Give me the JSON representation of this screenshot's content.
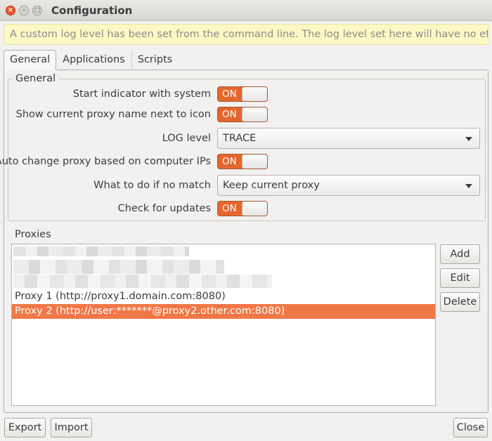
{
  "window": {
    "title": "Configuration",
    "close_glyph": "×",
    "min_glyph": "–",
    "max_glyph": "□"
  },
  "infobar": {
    "text": "A custom log level has been set from the command line. The log level set here will have no effect."
  },
  "tabs": [
    {
      "label": "General"
    },
    {
      "label": "Applications"
    },
    {
      "label": "Scripts"
    }
  ],
  "general": {
    "group_title": "General",
    "start_indicator": {
      "label": "Start indicator with system",
      "state": "ON"
    },
    "show_proxy_name": {
      "label": "Show current proxy name next to icon",
      "state": "ON"
    },
    "log_level": {
      "label": "LOG level",
      "value": "TRACE"
    },
    "auto_change": {
      "label": "Auto change proxy based on computer IPs",
      "state": "ON"
    },
    "no_match": {
      "label": "What to do if no match",
      "value": "Keep current proxy"
    },
    "check_updates": {
      "label": "Check for updates",
      "state": "ON"
    }
  },
  "proxies": {
    "group_title": "Proxies",
    "items": [
      {
        "label": "Proxy 1 (http://proxy1.domain.com:8080)",
        "selected": false
      },
      {
        "label": "Proxy 2 (http://user:*******@proxy2.other.com:8080)",
        "selected": true
      }
    ],
    "add_label": "Add",
    "edit_label": "Edit",
    "delete_label": "Delete"
  },
  "footer": {
    "export_label": "Export",
    "import_label": "Import",
    "close_label": "Close"
  },
  "colors": {
    "accent": "#f07746",
    "toggle_on": "#e4662c",
    "infobar_bg": "#fcf8c4"
  }
}
